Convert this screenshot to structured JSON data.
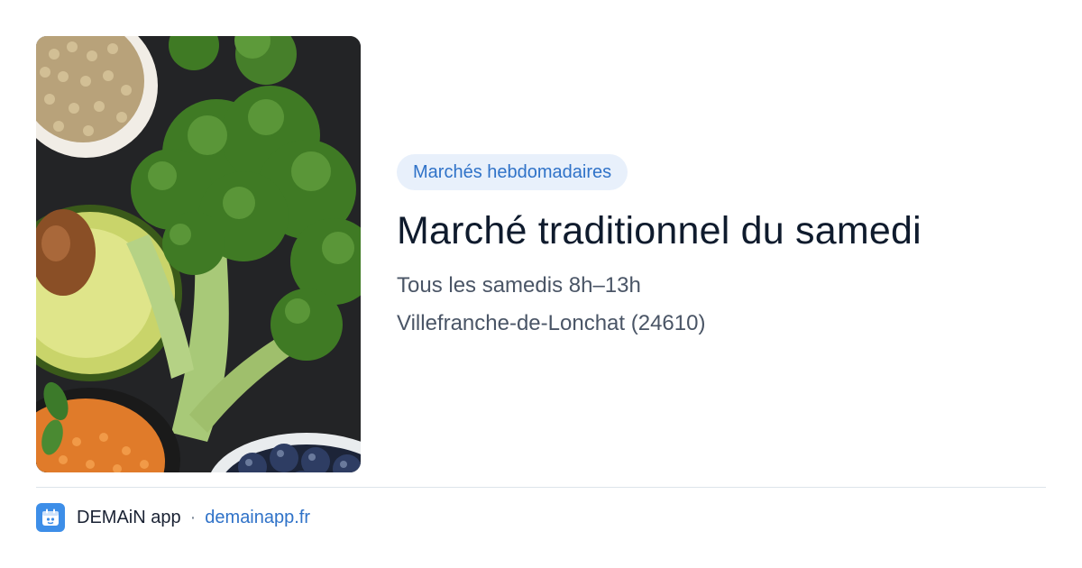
{
  "image": {
    "alt": "Légumes frais : brocoli, avocat, lentilles et myrtilles"
  },
  "badge": {
    "label": "Marchés hebdomadaires"
  },
  "title": "Marché traditionnel du samedi",
  "schedule": "Tous les samedis 8h–13h",
  "location": "Villefranche-de-Lonchat (24610)",
  "footer": {
    "brand": "DEMAiN app",
    "separator": "·",
    "site": "demainapp.fr",
    "logo_icon": "app-calendar-icon"
  },
  "colors": {
    "accent": "#2f72c8",
    "badge_bg": "#e8f0fb",
    "logo_bg": "#3d8ee8"
  }
}
